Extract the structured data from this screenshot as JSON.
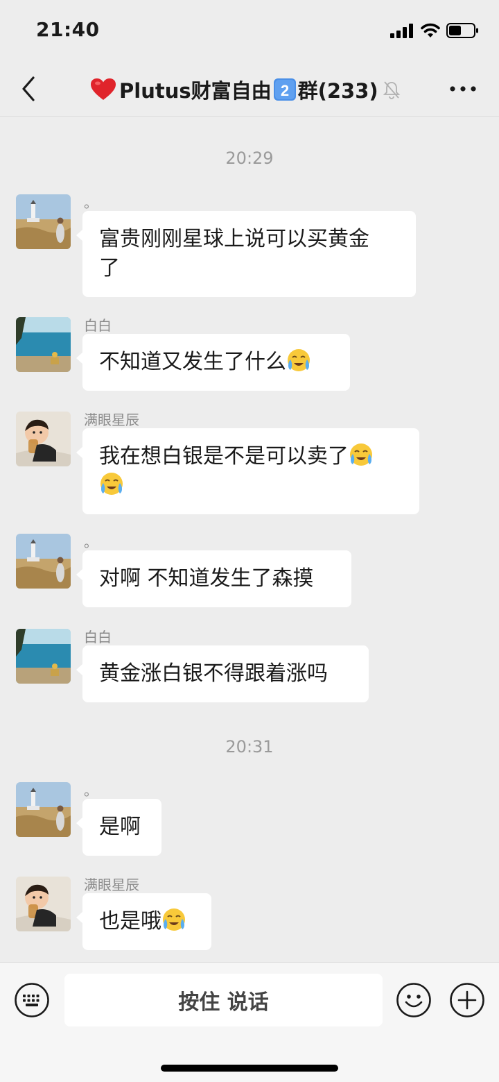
{
  "status_bar": {
    "time": "21:40"
  },
  "header": {
    "title_prefix": "Plutus财富自由",
    "title_number": "2",
    "title_suffix": "群(233)",
    "icons": [
      "heart-icon",
      "keycap-2-icon",
      "mute-bell-icon",
      "more-icon",
      "back-chevron-icon"
    ]
  },
  "messages": [
    {
      "time_separator": "20:29"
    },
    {
      "sender": "。",
      "text": "富贵刚刚星球上说可以买黄金了",
      "lines": [
        "富贵刚刚星球上说可以买黄金",
        "了"
      ],
      "avatar": "lighthouse-field-avatar"
    },
    {
      "sender": "白白",
      "text": "不知道又发生了什么",
      "emoji": "crying-face-icon",
      "avatar": "lake-avatar"
    },
    {
      "sender": "满眼星辰",
      "text": "我在想白银是不是可以卖了",
      "emoji_count": 2,
      "avatar": "baby-avatar"
    },
    {
      "sender": "。",
      "text": "对啊 不知道发生了森摸",
      "avatar": "lighthouse-field-avatar"
    },
    {
      "sender": "白白",
      "text": "黄金涨白银不得跟着涨吗",
      "avatar": "lake-avatar"
    },
    {
      "time_separator": "20:31"
    },
    {
      "sender": "。",
      "text": "是啊",
      "avatar": "lighthouse-field-avatar"
    },
    {
      "sender": "满眼星辰",
      "text": "也是哦",
      "emoji": "crying-face-icon",
      "avatar": "baby-avatar"
    }
  ],
  "time_separators": [
    "20:29",
    "20:31"
  ],
  "msgs": [
    {
      "sender": "。",
      "line1": "富贵刚刚星球上说可以买黄金",
      "line2": "了"
    },
    {
      "sender": "白白",
      "text": "不知道又发生了什么"
    },
    {
      "sender": "满眼星辰",
      "text": "我在想白银是不是可以卖了"
    },
    {
      "sender": "。",
      "text": "对啊 不知道发生了森摸"
    },
    {
      "sender": "白白",
      "text": "黄金涨白银不得跟着涨吗"
    },
    {
      "sender": "。",
      "text": "是啊"
    },
    {
      "sender": "满眼星辰",
      "text": "也是哦"
    }
  ],
  "input_bar": {
    "hold_to_talk_label": "按住 说话",
    "icons": [
      "keyboard-icon",
      "emoji-face-icon",
      "plus-icon"
    ]
  },
  "colors": {
    "background": "#ededed",
    "bubble": "#ffffff",
    "heart": "#e0242b",
    "keycap": "#4a8fe7"
  }
}
